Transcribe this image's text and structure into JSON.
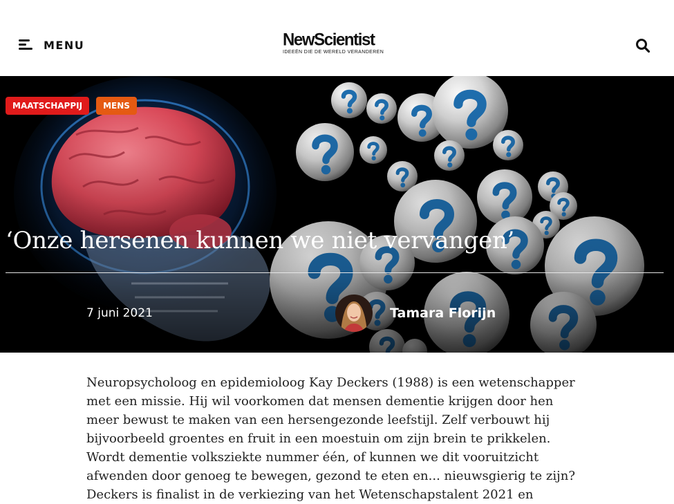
{
  "header": {
    "menu_label": "MENU",
    "logo_main": "NewScientist",
    "logo_tagline": "IDEEËN DIE DE WERELD VERANDEREN",
    "icons": {
      "menu": "hamburger-icon",
      "search": "search-icon"
    }
  },
  "hero": {
    "tags": [
      {
        "label": "MAATSCHAPPIJ",
        "color": "#e01b1b"
      },
      {
        "label": "MENS",
        "color": "#e55a12"
      }
    ],
    "title": "‘Onze hersenen kunnen we niet vervangen’",
    "date": "7 juni 2021",
    "author": "Tamara Florijn"
  },
  "article": {
    "intro": "Neuropsycholoog en epidemioloog Kay Deckers (1988) is een wetenschapper met een missie. Hij wil voorkomen dat mensen dementie krijgen door hen meer bewust te maken van een hersengezonde leefstijl. Zelf verbouwt hij bijvoorbeeld groentes en fruit in een moestuin om zijn brein te prikkelen. Wordt dementie volksziekte nummer één, of kunnen we dit vooruitzicht afwenden door genoeg te bewegen, gezond te eten en... nieuwsgierig te zijn? Deckers is finalist in de verkiezing van het Wetenschapstalent 2021 en"
  }
}
